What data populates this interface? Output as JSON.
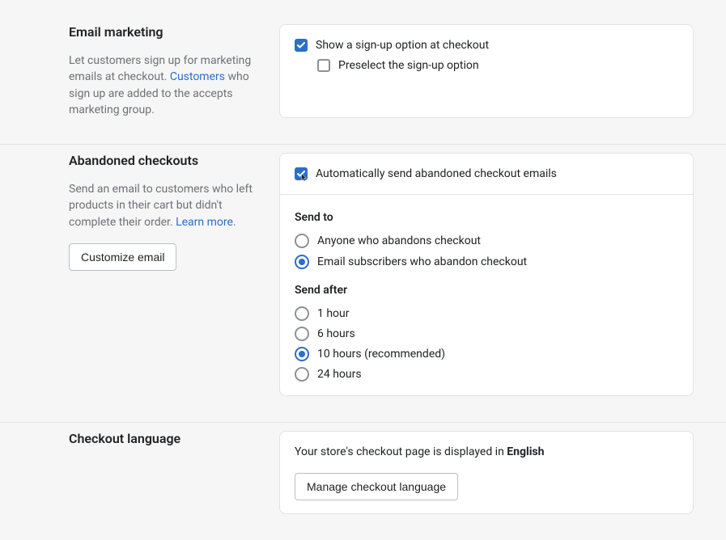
{
  "emailMarketing": {
    "title": "Email marketing",
    "descPrefix": "Let customers sign up for marketing emails at checkout. ",
    "descLink": "Customers",
    "descSuffix": " who sign up are added to the accepts marketing group.",
    "showSignupLabel": "Show a sign-up option at checkout",
    "preselectLabel": "Preselect the sign-up option"
  },
  "abandoned": {
    "title": "Abandoned checkouts",
    "descPrefix": "Send an email to customers who left products in their cart but didn't complete their order. ",
    "learnMore": "Learn more",
    "descSuffix": ".",
    "customizeBtn": "Customize email",
    "autoSendLabel": "Automatically send abandoned checkout emails",
    "sendToTitle": "Send to",
    "sendTo": {
      "anyone": "Anyone who abandons checkout",
      "subscribers": "Email subscribers who abandon checkout"
    },
    "sendAfterTitle": "Send after",
    "sendAfter": {
      "h1": "1 hour",
      "h6": "6 hours",
      "h10": "10 hours (recommended)",
      "h24": "24 hours"
    }
  },
  "language": {
    "title": "Checkout language",
    "textPrefix": "Your store's checkout page is displayed in ",
    "languageName": "English",
    "manageBtn": "Manage checkout language"
  }
}
